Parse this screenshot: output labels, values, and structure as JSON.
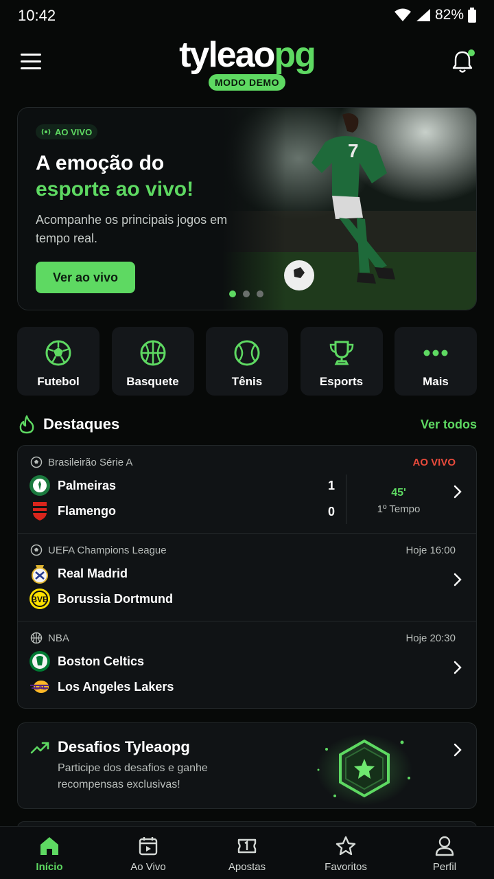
{
  "status_bar": {
    "time": "10:42",
    "battery": "82%"
  },
  "header": {
    "logo_white": "tyleao",
    "logo_green": "pg",
    "badge": "MODO DEMO"
  },
  "hero": {
    "live_tag": "AO VIVO",
    "title_line1": "A emoção do",
    "title_line2": "esporte ao vivo!",
    "subtitle": "Acompanhe os principais jogos em tempo real.",
    "button": "Ver ao vivo",
    "jersey_number": "7",
    "carousel": {
      "pages": 3,
      "active": 1
    }
  },
  "categories": [
    {
      "label": "Futebol",
      "icon": "soccer-ball-icon"
    },
    {
      "label": "Basquete",
      "icon": "basketball-icon"
    },
    {
      "label": "Tênis",
      "icon": "tennis-ball-icon"
    },
    {
      "label": "Esports",
      "icon": "trophy-icon"
    },
    {
      "label": "Mais",
      "icon": "more-dots-icon"
    }
  ],
  "highlights": {
    "title": "Destaques",
    "see_all": "Ver todos",
    "matches": [
      {
        "league": "Brasileirão Série A",
        "status": "AO VIVO",
        "home": "Palmeiras",
        "away": "Flamengo",
        "home_score": "1",
        "away_score": "0",
        "minute": "45'",
        "period": "1º Tempo"
      },
      {
        "league": "UEFA Champions League",
        "status": "Hoje 16:00",
        "home": "Real Madrid",
        "away": "Borussia Dortmund"
      },
      {
        "league": "NBA",
        "status": "Hoje 20:30",
        "home": "Boston Celtics",
        "away": "Los Angeles Lakers"
      }
    ]
  },
  "challenge": {
    "title": "Desafios Tyleaopg",
    "description": "Participe dos desafios e ganhe recompensas exclusivas!"
  },
  "bottom_nav": [
    {
      "label": "Início",
      "active": true
    },
    {
      "label": "Ao Vivo",
      "active": false
    },
    {
      "label": "Apostas",
      "active": false
    },
    {
      "label": "Favoritos",
      "active": false
    },
    {
      "label": "Perfil",
      "active": false
    }
  ],
  "colors": {
    "accent": "#5ed962",
    "live_red": "#e94b3c",
    "background": "#070908",
    "card": "#101315"
  }
}
